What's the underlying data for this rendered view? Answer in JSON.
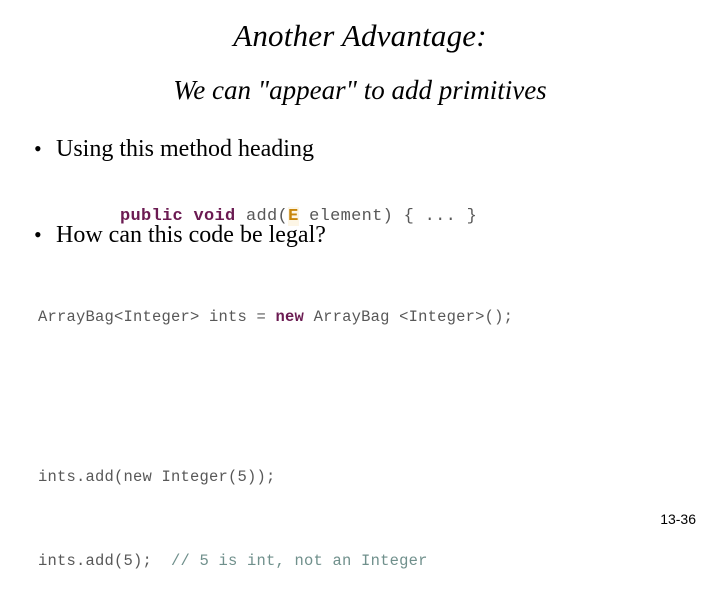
{
  "slide": {
    "title": "Another Advantage:",
    "subtitle": "We can \"appear\" to add primitives",
    "page_number": "13-36",
    "bullet_marker": "•",
    "bullets": [
      {
        "text": "Using this method heading"
      },
      {
        "text": "How can this code be legal?"
      }
    ],
    "code_signature": {
      "keywords": "public void ",
      "method": "add(",
      "type_parameter": "E",
      "params": " element) { ... }"
    },
    "code_block": {
      "line1_before_new": "ArrayBag<Integer> ints = ",
      "line1_new": "new",
      "line1_after_new": " ArrayBag <Integer>();",
      "line2": "ints.add(new Integer(5));",
      "line3_code": "ints.add(5);  ",
      "line3_comment": "// 5 is int, not an Integer"
    }
  },
  "colors": {
    "keyword_purple": "#6b1b52",
    "type_parameter_amber": "#c8860b",
    "code_gray": "#585858",
    "comment_slate": "#70908c",
    "background": "#ffffff",
    "text_black": "#000000"
  }
}
